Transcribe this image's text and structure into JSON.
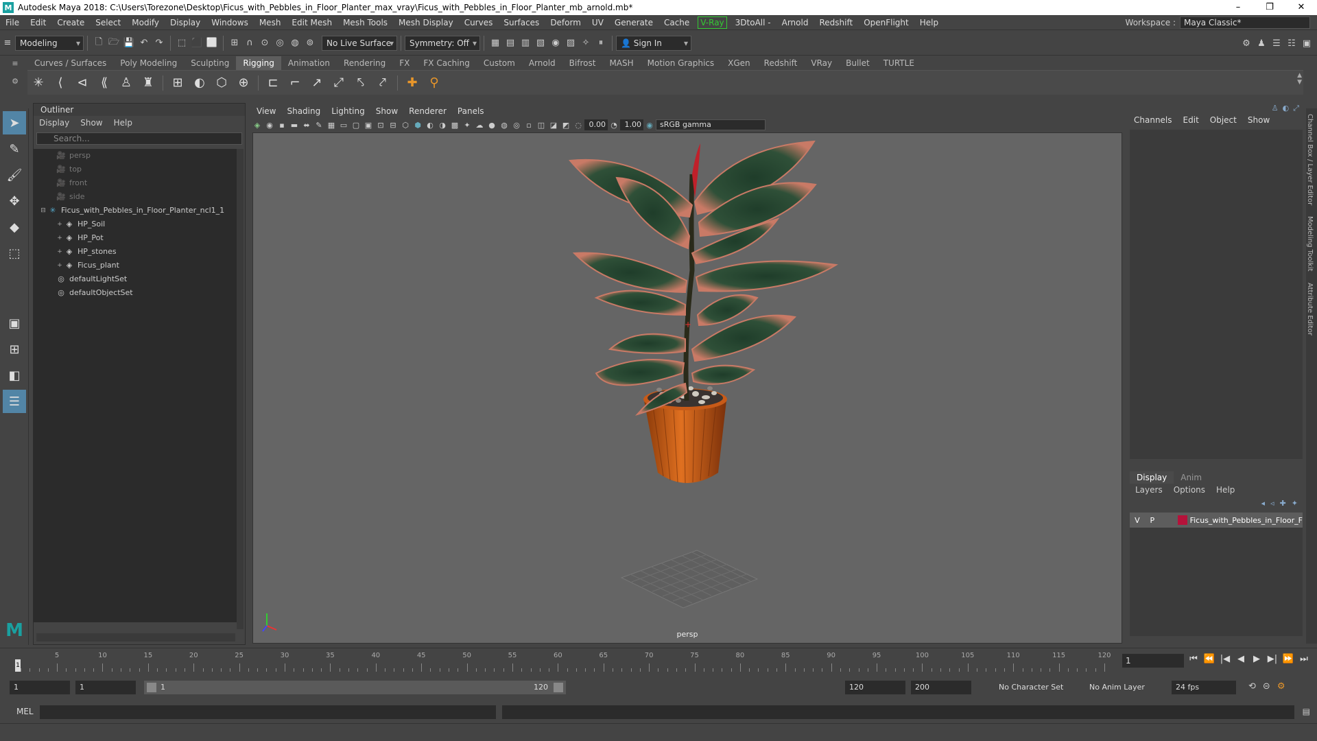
{
  "window": {
    "title": "Autodesk Maya 2018: C:\\Users\\Torezone\\Desktop\\Ficus_with_Pebbles_in_Floor_Planter_max_vray\\Ficus_with_Pebbles_in_Floor_Planter_mb_arnold.mb*",
    "logo": "M",
    "controls": [
      "–",
      "❐",
      "✕"
    ]
  },
  "menubar": {
    "items": [
      "File",
      "Edit",
      "Create",
      "Select",
      "Modify",
      "Display",
      "Windows",
      "Mesh",
      "Edit Mesh",
      "Mesh Tools",
      "Mesh Display",
      "Curves",
      "Surfaces",
      "Deform",
      "UV",
      "Generate",
      "Cache"
    ],
    "vray": "V-Ray",
    "items2": [
      "3DtoAll -",
      "Arnold",
      "Redshift",
      "OpenFlight",
      "Help"
    ],
    "workspace_label": "Workspace :",
    "workspace_value": "Maya Classic*"
  },
  "statusline": {
    "mode": "Modeling",
    "live_surface": "No Live Surface",
    "symmetry": "Symmetry: Off",
    "sign_in": "Sign In"
  },
  "shelf": {
    "tabs": [
      "Curves / Surfaces",
      "Poly Modeling",
      "Sculpting",
      "Rigging",
      "Animation",
      "Rendering",
      "FX",
      "FX Caching",
      "Custom",
      "Arnold",
      "Bifrost",
      "MASH",
      "Motion Graphics",
      "XGen",
      "Redshift",
      "VRay",
      "Bullet",
      "TURTLE"
    ],
    "active": "Rigging"
  },
  "outliner": {
    "title": "Outliner",
    "menu": [
      "Display",
      "Show",
      "Help"
    ],
    "search_placeholder": "Search...",
    "nodes": [
      {
        "label": "persp",
        "depth": 1,
        "icon": "camera-icon",
        "dim": true,
        "exp": ""
      },
      {
        "label": "top",
        "depth": 1,
        "icon": "camera-icon",
        "dim": true,
        "exp": ""
      },
      {
        "label": "front",
        "depth": 1,
        "icon": "camera-icon",
        "dim": true,
        "exp": ""
      },
      {
        "label": "side",
        "depth": 1,
        "icon": "camera-icon",
        "dim": true,
        "exp": ""
      },
      {
        "label": "Ficus_with_Pebbles_in_Floor_Planter_ncl1_1",
        "depth": 0,
        "icon": "group-icon",
        "dim": false,
        "exp": "⊟"
      },
      {
        "label": "HP_Soil",
        "depth": 2,
        "icon": "mesh-icon",
        "dim": false,
        "exp": "+"
      },
      {
        "label": "HP_Pot",
        "depth": 2,
        "icon": "mesh-icon",
        "dim": false,
        "exp": "+"
      },
      {
        "label": "HP_stones",
        "depth": 2,
        "icon": "mesh-icon",
        "dim": false,
        "exp": "+"
      },
      {
        "label": "Ficus_plant",
        "depth": 2,
        "icon": "mesh-icon",
        "dim": false,
        "exp": "+"
      },
      {
        "label": "defaultLightSet",
        "depth": 1,
        "icon": "set-icon",
        "dim": false,
        "exp": ""
      },
      {
        "label": "defaultObjectSet",
        "depth": 1,
        "icon": "set-icon",
        "dim": false,
        "exp": ""
      }
    ]
  },
  "viewport": {
    "menu": [
      "View",
      "Shading",
      "Lighting",
      "Show",
      "Renderer",
      "Panels"
    ],
    "exposure": "0.00",
    "gamma": "1.00",
    "color_space": "sRGB gamma",
    "camera_label": "persp"
  },
  "channelbox": {
    "menu": [
      "Channels",
      "Edit",
      "Object",
      "Show"
    ],
    "layer_tabs": [
      "Display",
      "Anim"
    ],
    "layer_menu": [
      "Layers",
      "Options",
      "Help"
    ],
    "layer": {
      "v": "V",
      "p": "P",
      "name": "Ficus_with_Pebbles_in_Floor_F",
      "color": "#b5123a"
    },
    "side_tabs": [
      "Channel Box / Layer Editor",
      "Modeling Toolkit",
      "Attribute Editor"
    ]
  },
  "timeline": {
    "ticks": [
      "5",
      "10",
      "15",
      "20",
      "25",
      "30",
      "35",
      "40",
      "45",
      "50",
      "55",
      "60",
      "65",
      "70",
      "75",
      "80",
      "85",
      "90",
      "95",
      "100",
      "105",
      "110",
      "115",
      "120"
    ],
    "playhead_label": "1",
    "current_frame": "1",
    "playback_icons": [
      "⏮",
      "⏪",
      "|◀",
      "◀",
      "▶",
      "▶|",
      "⏩",
      "⏭"
    ]
  },
  "range": {
    "start": "1",
    "inner_start": "1",
    "slider_start": "1",
    "slider_end": "120",
    "end": "120",
    "outer_end": "200",
    "character_set": "No Character Set",
    "anim_layer": "No Anim Layer",
    "fps": "24 fps"
  },
  "cmdline": {
    "label": "MEL"
  }
}
